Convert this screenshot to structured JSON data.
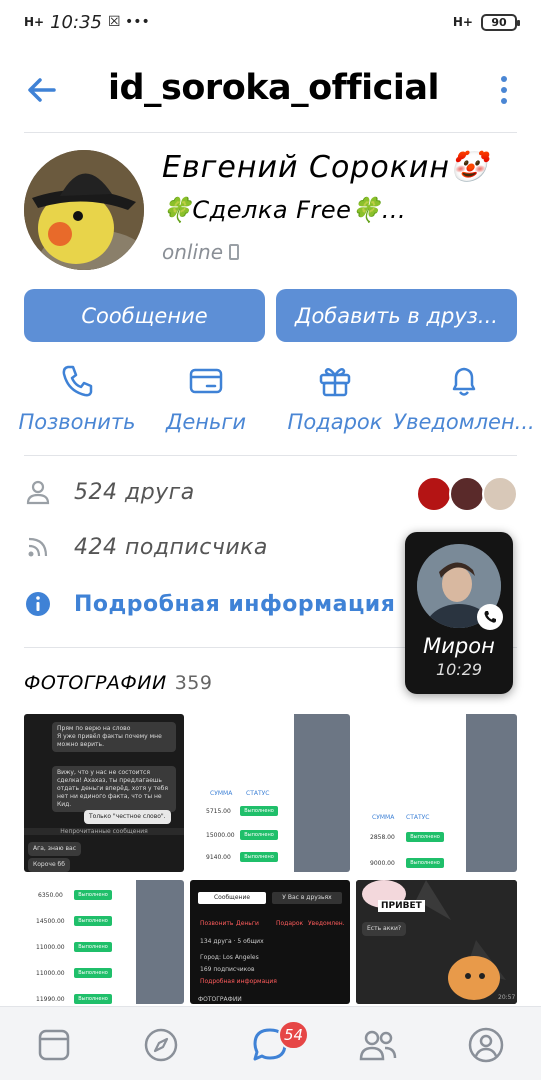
{
  "status_bar": {
    "network_left": "H+",
    "time": "10:35",
    "network_right": "H+",
    "battery": "90"
  },
  "header": {
    "title": "id_soroka_official"
  },
  "profile": {
    "name": "Евгений Сорокин🤡",
    "status": "🍀Сделка Free🍀...",
    "online": "online"
  },
  "buttons": {
    "message": "Сообщение",
    "add_friend": "Добавить в друз..."
  },
  "actions": [
    {
      "label": "Позвонить",
      "icon": "phone-icon"
    },
    {
      "label": "Деньги",
      "icon": "wallet-icon"
    },
    {
      "label": "Подарок",
      "icon": "gift-icon"
    },
    {
      "label": "Уведомлен...",
      "icon": "bell-icon"
    }
  ],
  "info": {
    "friends": "524 друга",
    "followers": "424 подписчика",
    "details": "Подробная информация"
  },
  "call_overlay": {
    "name": "Мирон",
    "time": "10:29"
  },
  "photos": {
    "title": "ФОТОГРАФИИ",
    "count": "359",
    "p1": {
      "b1": "Прям по верю на слово",
      "b1b": "Я уже привёл факты почему мне можно верить.",
      "b2": "Вижу, что у нас не состоится сделка! Ахахаз, ты предлагаешь отдать деньги вперёд, хотя у тебя нет ни единого факта, что ты не Кид.",
      "b3": "Только \"честное слово\".",
      "b4": "Непрочитанные сообщения",
      "b5": "Ага, знаю вас",
      "b6": "Короче бб"
    },
    "p2": {
      "col1": "СУММА",
      "col2": "СТАТУС",
      "rows": [
        "5715.00",
        "15000.00",
        "9140.00"
      ],
      "badge": "Выполнено"
    },
    "p3": {
      "col1": "СУММА",
      "col2": "СТАТУС",
      "rows": [
        "2858.00",
        "9000.00"
      ],
      "badge": "Выполнено"
    },
    "p4": {
      "rows": [
        "6350.00",
        "14500.00",
        "11000.00",
        "11000.00",
        "11990.00"
      ],
      "badge": "Выполнено"
    },
    "p5": {
      "btn1": "Сообщение",
      "btn2": "У Вас в друзьях",
      "a1": "Позвонить",
      "a2": "Деньги",
      "a3": "Подарок",
      "a4": "Уведомлен.",
      "l1": "134 друга · 5 общих",
      "l2": "Город: Los Angeles",
      "l3": "169 подписчиков",
      "l4": "Подробная информация",
      "footer": "ФОТОГРАФИИ"
    },
    "p6": {
      "sticker": "ПРИВЕТ",
      "msg": "Есть акки?",
      "time": "20:57"
    }
  },
  "bottom_nav": {
    "badge": "54"
  }
}
